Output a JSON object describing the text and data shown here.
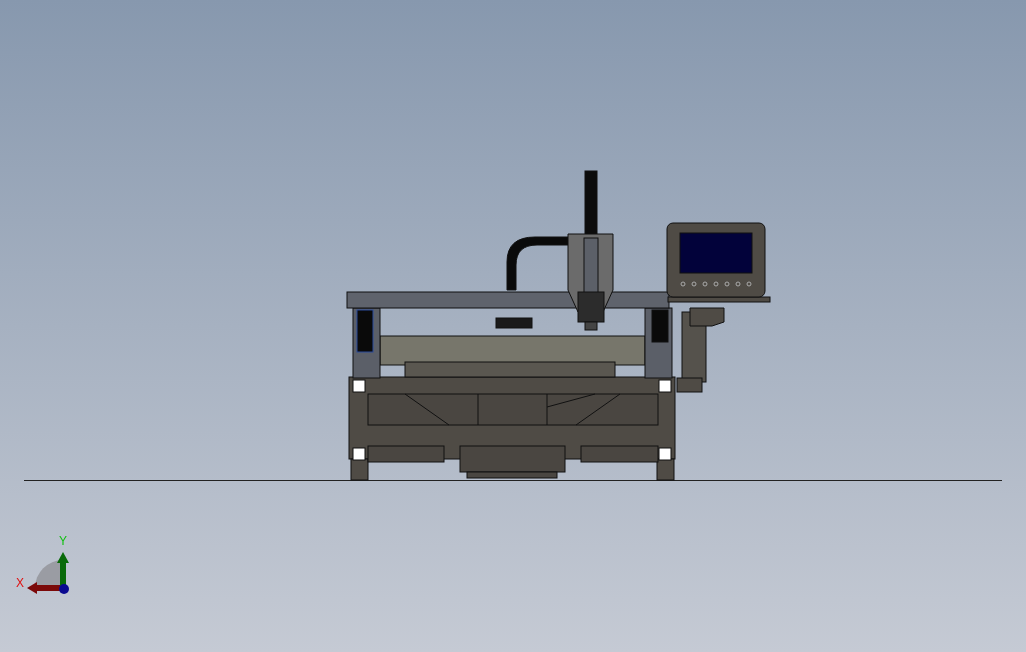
{
  "viewport": {
    "axes": [
      {
        "kind": "x",
        "label": "X",
        "color": "#e01010"
      },
      {
        "kind": "y",
        "label": "Y",
        "color": "#10c010"
      }
    ]
  }
}
